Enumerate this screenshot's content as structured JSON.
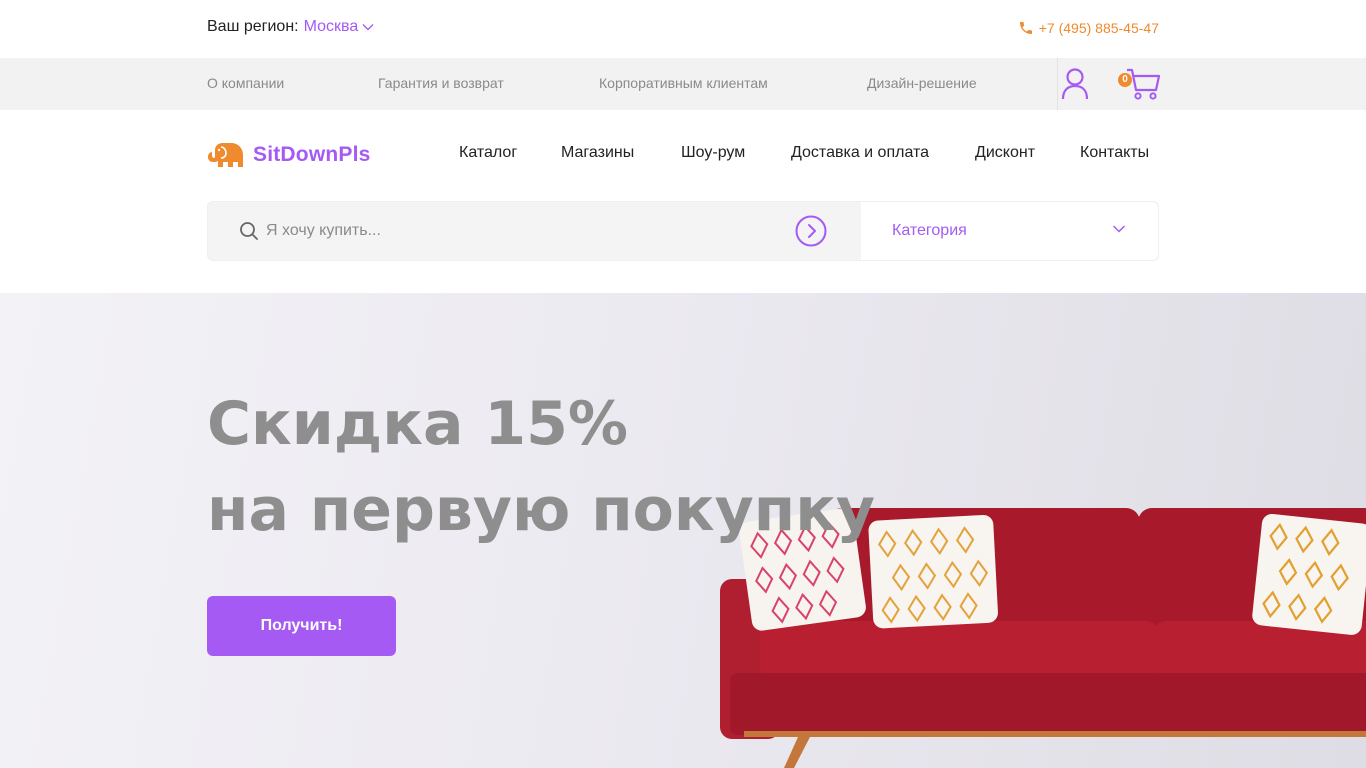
{
  "topbar": {
    "region_label": "Ваш регион:",
    "region_city": "Москва",
    "phone": "+7 (495) 885-45-47"
  },
  "subnav": {
    "links": [
      "О компании",
      "Гарантия и возврат",
      "Корпоративным клиентам",
      "Дизайн-решение"
    ],
    "cart_count": "0"
  },
  "header": {
    "logo_text": "SitDownPls",
    "nav": [
      "Каталог",
      "Магазины",
      "Шоу-рум",
      "Доставка и оплата",
      "Дисконт",
      "Контакты"
    ]
  },
  "search": {
    "placeholder": "Я хочу купить...",
    "category_label": "Категория"
  },
  "hero": {
    "title_line1": "Скидка 15%",
    "title_line2": "на первую покупку",
    "button_label": "Получить!"
  },
  "colors": {
    "accent": "#a55af4",
    "orange": "#f08a2e",
    "sofa": "#b01a2c"
  }
}
